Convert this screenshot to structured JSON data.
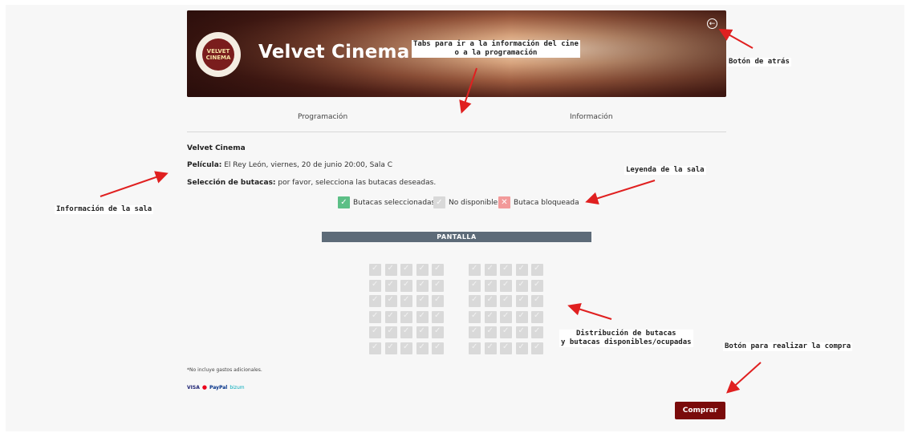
{
  "app": {
    "cinema_name": "Velvet Cinema",
    "logo_text": "VELVET CINEMA"
  },
  "tabs": [
    {
      "label": "Programación"
    },
    {
      "label": "Información"
    }
  ],
  "info": {
    "cinema": "Velvet Cinema",
    "movie_label": "Película:",
    "movie_value": "El Rey León, viernes, 20 de junio 20:00, Sala C",
    "seats_label": "Selección de butacas:",
    "seats_value": "por favor, selecciona las butacas deseadas."
  },
  "legend": [
    {
      "label": "Butacas seleccionadas",
      "color": "#5cbf86",
      "icon": "check-icon"
    },
    {
      "label": "No disponible",
      "color": "#d9d9d9",
      "icon": "check-icon"
    },
    {
      "label": "Butaca bloqueada",
      "color": "#f29a9a",
      "icon": "x-icon"
    }
  ],
  "screen_label": "PANTALLA",
  "seat_map": {
    "rows": 6,
    "blocks": 2,
    "seats_per_block": 5,
    "status": "no-disponible"
  },
  "note": "*No incluye gastos adicionales.",
  "payments": [
    "VISA",
    "mastercard",
    "PayPal",
    "bizum"
  ],
  "buy_button": "Comprar",
  "annotations": {
    "tabs": [
      "Tabs para ir a la información del cine",
      "o a la programación"
    ],
    "back": "Botón de atrás",
    "room_info": "Información de la sala",
    "legend": "Leyenda de la sala",
    "seats": [
      "Distribución de butacas",
      "y butacas disponibles/ocupadas"
    ],
    "buy": "Botón para realizar la compra"
  },
  "colors": {
    "accent": "#7a0b0b",
    "screen_bar": "#5d6b78",
    "arrow": "#e02020"
  }
}
